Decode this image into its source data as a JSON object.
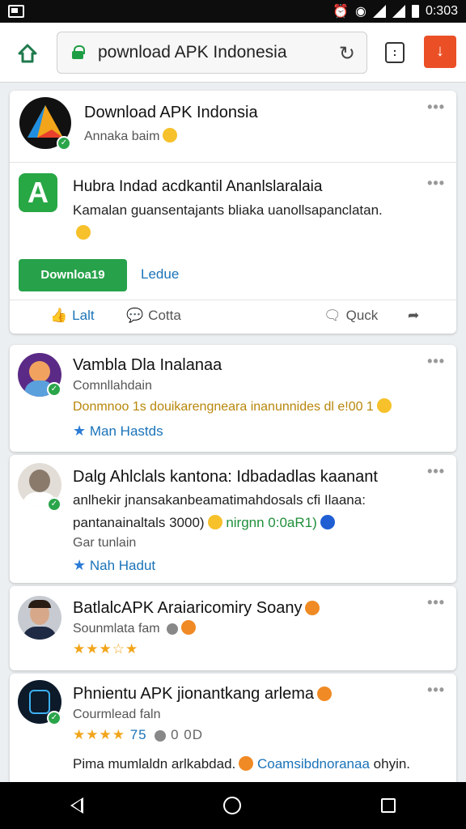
{
  "status": {
    "time": "0:303"
  },
  "browser": {
    "url": "pownload APK Indonesia",
    "tabs_count": ":"
  },
  "header_card": {
    "title": "Download APK  Indonsia",
    "subtitle": "Annaka baim"
  },
  "post1": {
    "title": "Hubra Indad acdkantil Ananlslaralaia",
    "body": "Kamalan guansentajants bliaka uanollsapanclatan.",
    "download": "Downloa19",
    "secondary": "Ledue",
    "like": "Lalt",
    "comment": "Cotta",
    "share": "Quck"
  },
  "post2": {
    "title": "Vambla Dla Inalanaa",
    "sub": "Comnllahdain",
    "body": "Donmnoo 1s douikarengneara inanunnides dl e!00 1",
    "link": "Man Hastds"
  },
  "post3": {
    "title": "Dalg Ahlclals kantona: Idbadadlas kaanant",
    "line2": "anlhekir jnansakanbeamatimahdosals cfi Ilaana:",
    "line3a": "pantanainaltals 3000)",
    "line3b": "nirgnn 0:0aR1)",
    "sub": "Gar   tunlain",
    "link": "Nah Hadut"
  },
  "post4": {
    "title": "BatlalcAPK Araiaricomiry Soany",
    "sub": "Sounmlata fam",
    "rating": "★★★☆★"
  },
  "post5": {
    "title": "Phnientu APK jionantkang arlema",
    "sub": "Courmlead faln",
    "stars": "★★★★",
    "score": "75",
    "score2": "0 0D",
    "body_a": "Pima mumlaldn arlkabdad.",
    "body_b": "Coamsibdnoranaa",
    "body_c": "ohyin."
  },
  "colors": {
    "accent_green": "#27a24b",
    "link_blue": "#1a73b8",
    "ext_orange": "#ea4f26"
  },
  "icons": [
    "home-icon",
    "lock-icon",
    "reload-icon",
    "tabs-icon",
    "extension-icon",
    "more-icon",
    "like-icon",
    "comment-icon",
    "chat-icon",
    "share-icon",
    "star-icon",
    "back-icon",
    "home-nav-icon",
    "recents-icon"
  ]
}
